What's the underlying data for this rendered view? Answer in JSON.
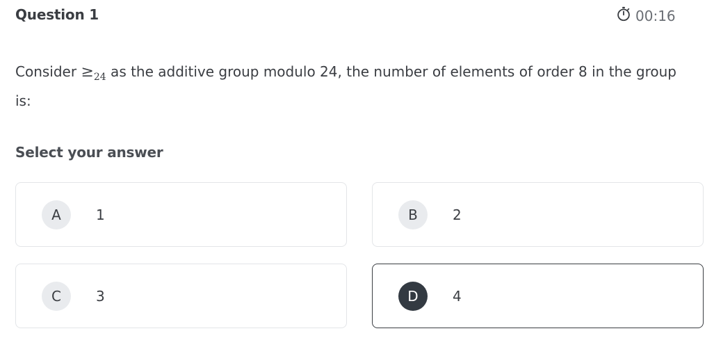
{
  "header": {
    "question_title": "Question 1",
    "timer": "00:16",
    "timer_icon": "stopwatch-icon"
  },
  "question": {
    "prefix": "Consider ",
    "math_symbol": "≥",
    "math_subscript": "24",
    "suffix": " as the additive group modulo 24, the number of elements of order 8 in the group is:"
  },
  "answers": {
    "label": "Select your answer",
    "selected": "D",
    "options": [
      {
        "letter": "A",
        "text": "1"
      },
      {
        "letter": "B",
        "text": "2"
      },
      {
        "letter": "C",
        "text": "3"
      },
      {
        "letter": "D",
        "text": "4"
      }
    ]
  },
  "colors": {
    "text": "#3a3d42",
    "muted": "#6a6e74",
    "border": "#e3e5e8",
    "selected_badge": "#333a42",
    "badge": "#e9ebee"
  }
}
